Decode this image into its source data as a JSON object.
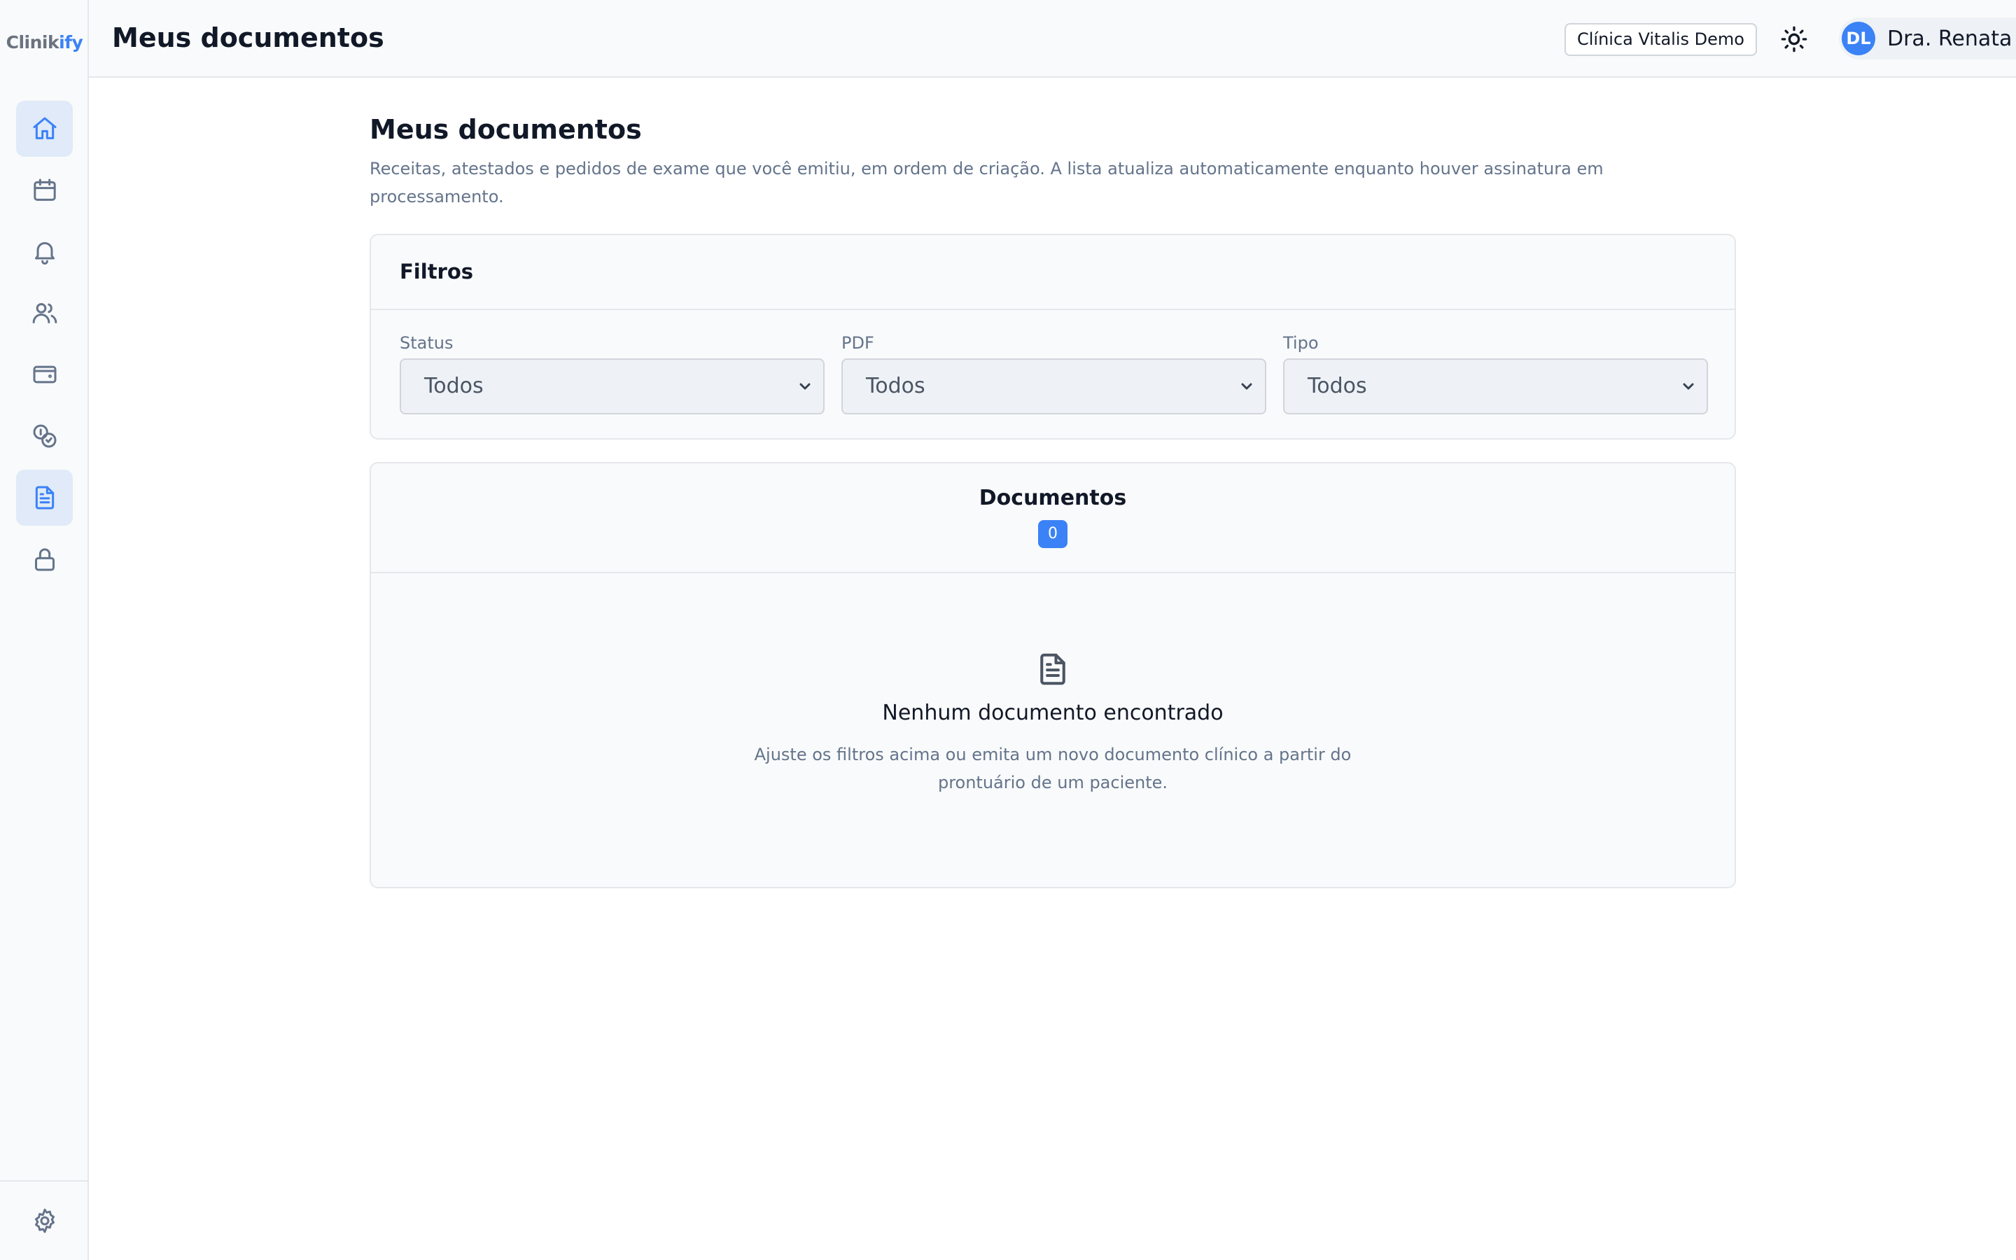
{
  "sidebar": {
    "logo_part1": "Clinik",
    "logo_part2": "ify",
    "items": [
      {
        "name": "home",
        "icon": "home-icon",
        "active": true
      },
      {
        "name": "calendar",
        "icon": "calendar-icon",
        "active": false
      },
      {
        "name": "notifications",
        "icon": "bell-icon",
        "active": false
      },
      {
        "name": "patients",
        "icon": "users-icon",
        "active": false
      },
      {
        "name": "wallet",
        "icon": "wallet-icon",
        "active": false
      },
      {
        "name": "billing",
        "icon": "coins-icon",
        "active": false
      },
      {
        "name": "documents",
        "icon": "file-text-icon",
        "active": true
      },
      {
        "name": "security",
        "icon": "lock-icon",
        "active": false
      }
    ],
    "settings_icon": "gear-icon"
  },
  "header": {
    "title": "Meus documentos",
    "clinic": "Clínica Vitalis Demo",
    "theme_icon": "sun-icon",
    "user_initials": "DL",
    "user_name": "Dra. Renata Lopes"
  },
  "main": {
    "title": "Meus documentos",
    "description": "Receitas, atestados e pedidos de exame que você emitiu, em ordem de criação. A lista atualiza automaticamente enquanto houver assinatura em processamento."
  },
  "filters": {
    "heading": "Filtros",
    "status": {
      "label": "Status",
      "value": "Todos"
    },
    "pdf": {
      "label": "PDF",
      "value": "Todos"
    },
    "tipo": {
      "label": "Tipo",
      "value": "Todos"
    }
  },
  "documents": {
    "heading": "Documentos",
    "count": "0",
    "empty_icon": "file-text-icon",
    "empty_title": "Nenhum documento encontrado",
    "empty_text": "Ajuste os filtros acima ou emita um novo documento clínico a partir do prontuário de um paciente."
  },
  "colors": {
    "accent": "#3b82f6",
    "sidebar_active_bg": "#e0eaf8",
    "muted_text": "#64748b"
  }
}
